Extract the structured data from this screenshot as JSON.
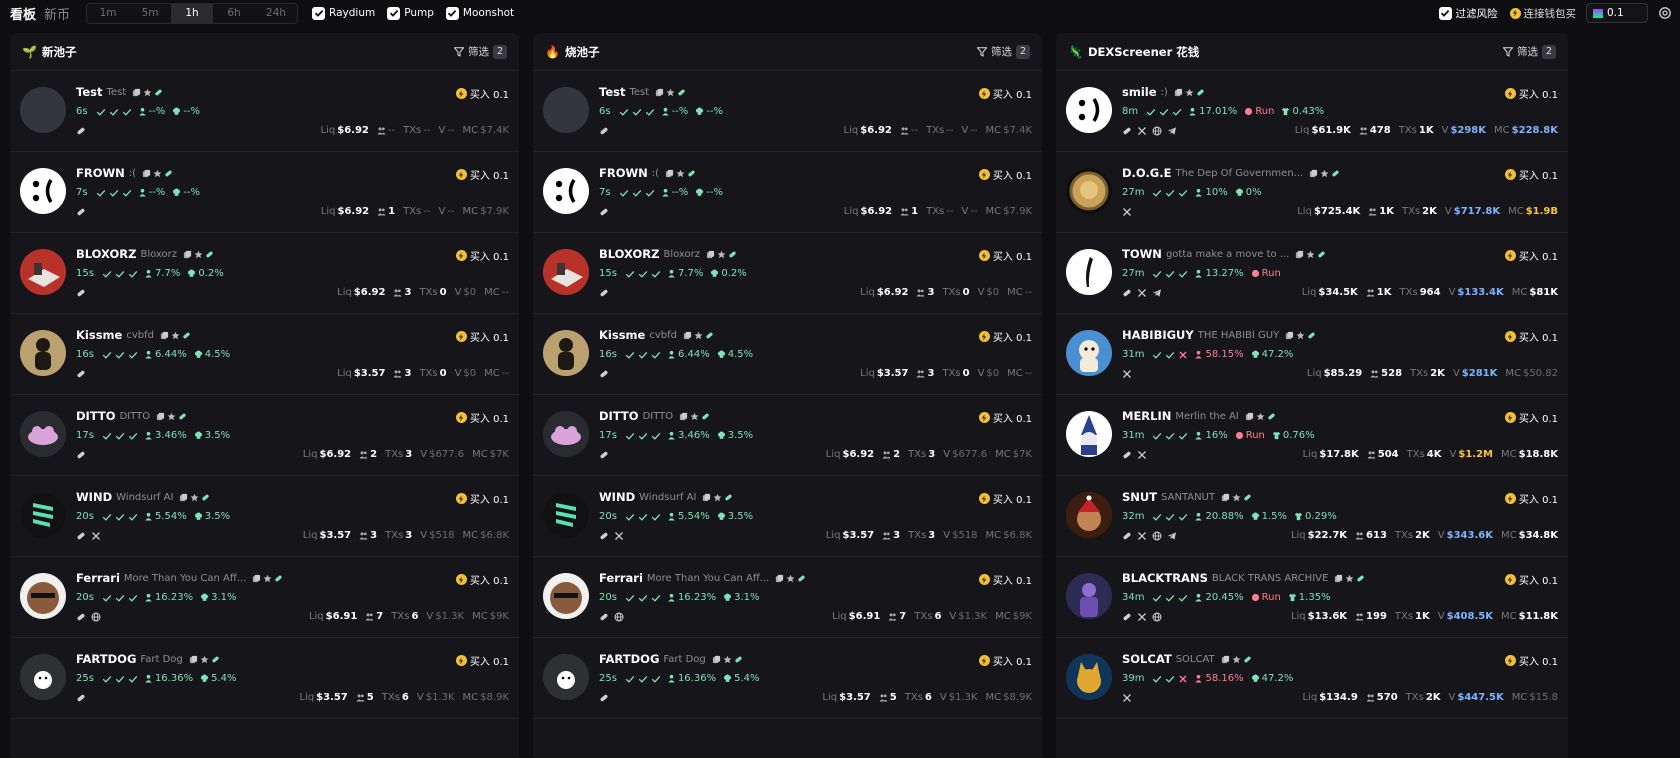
{
  "header": {
    "title": "看板",
    "subtitle": "新币",
    "timeframes": [
      "1m",
      "5m",
      "1h",
      "6h",
      "24h"
    ],
    "active_timeframe": "1h",
    "toggles": [
      "Raydium",
      "Pump",
      "Moonshot"
    ],
    "risk_filter": "过滤风险",
    "connect": "连接钱包买",
    "amount": "0.1"
  },
  "colors": {
    "accent_green": "#7fe3b3",
    "accent_red": "#ff7b8f",
    "accent_blue": "#7cb4ff",
    "accent_yellow": "#f5c542",
    "panel": "#16161a"
  },
  "metric_labels": {
    "liq": "Liq",
    "txs": "TXs",
    "vol": "V",
    "mc": "MC"
  },
  "buy_label": "买入 0.1",
  "filter_label": "筛选",
  "columns": [
    {
      "title": "新池子",
      "icon": "seedling-icon",
      "emoji": "🌱",
      "filter_count": "2",
      "rows": [
        {
          "name": "Test",
          "sub": "Test",
          "age": "6s",
          "c": [
            "g",
            "g",
            "g"
          ],
          "p1": "--%",
          "p2": "--%",
          "soc": [
            "pill"
          ],
          "liq": "$6.92",
          "holders": "--",
          "txs": "--",
          "v": "--",
          "mc": "$7.4K",
          "av": "blank"
        },
        {
          "name": "FROWN",
          "sub": ":(",
          "age": "7s",
          "c": [
            "g",
            "g",
            "g"
          ],
          "p1": "--%",
          "p2": "--%",
          "soc": [
            "pill"
          ],
          "liq": "$6.92",
          "holders": "1",
          "txs": "--",
          "v": "--",
          "mc": "$7.9K",
          "av": "frown"
        },
        {
          "name": "BLOXORZ",
          "sub": "Bloxorz",
          "age": "15s",
          "c": [
            "g",
            "g",
            "g"
          ],
          "p1": "7.7%",
          "p2": "0.2%",
          "soc": [
            "pill"
          ],
          "liq": "$6.92",
          "holders": "3",
          "txs": "0",
          "v": "$0",
          "mc": "--",
          "av": "blox"
        },
        {
          "name": "Kissme",
          "sub": "cvbfd",
          "age": "16s",
          "c": [
            "g",
            "g",
            "g"
          ],
          "p1": "6.44%",
          "p2": "4.5%",
          "soc": [
            "pill"
          ],
          "liq": "$3.57",
          "holders": "3",
          "txs": "0",
          "v": "$0",
          "mc": "--",
          "av": "kiss"
        },
        {
          "name": "DITTO",
          "sub": "DITTO",
          "age": "17s",
          "c": [
            "g",
            "g",
            "g"
          ],
          "p1": "3.46%",
          "p2": "3.5%",
          "soc": [
            "pill"
          ],
          "liq": "$6.92",
          "holders": "2",
          "txs": "3",
          "v": "$677.6",
          "mc": "$7K",
          "av": "ditto"
        },
        {
          "name": "WIND",
          "sub": "Windsurf AI",
          "age": "20s",
          "c": [
            "g",
            "g",
            "g"
          ],
          "p1": "5.54%",
          "p2": "3.5%",
          "soc": [
            "pill",
            "x"
          ],
          "liq": "$3.57",
          "holders": "3",
          "txs": "3",
          "v": "$518",
          "mc": "$6.8K",
          "av": "wind"
        },
        {
          "name": "Ferrari",
          "sub": "More Than You Can Aff...",
          "age": "20s",
          "c": [
            "g",
            "g",
            "g"
          ],
          "p1": "16.23%",
          "p2": "3.1%",
          "soc": [
            "pill",
            "web"
          ],
          "liq": "$6.91",
          "holders": "7",
          "txs": "6",
          "v": "$1.3K",
          "mc": "$9K",
          "av": "ferrari"
        },
        {
          "name": "FARTDOG",
          "sub": "Fart Dog",
          "age": "25s",
          "c": [
            "g",
            "g",
            "g"
          ],
          "p1": "16.36%",
          "p2": "5.4%",
          "soc": [
            "pill"
          ],
          "liq": "$3.57",
          "holders": "5",
          "txs": "6",
          "v": "$1.3K",
          "mc": "$8.9K",
          "av": "fart"
        }
      ]
    },
    {
      "title": "烧池子",
      "icon": "fire-icon",
      "emoji": "🔥",
      "filter_count": "2",
      "rows": [
        {
          "name": "Test",
          "sub": "Test",
          "age": "6s",
          "c": [
            "g",
            "g",
            "g"
          ],
          "p1": "--%",
          "p2": "--%",
          "soc": [
            "pill"
          ],
          "liq": "$6.92",
          "holders": "--",
          "txs": "--",
          "v": "--",
          "mc": "$7.4K",
          "av": "blank"
        },
        {
          "name": "FROWN",
          "sub": ":(",
          "age": "7s",
          "c": [
            "g",
            "g",
            "g"
          ],
          "p1": "--%",
          "p2": "--%",
          "soc": [
            "pill"
          ],
          "liq": "$6.92",
          "holders": "1",
          "txs": "--",
          "v": "--",
          "mc": "$7.9K",
          "av": "frown"
        },
        {
          "name": "BLOXORZ",
          "sub": "Bloxorz",
          "age": "15s",
          "c": [
            "g",
            "g",
            "g"
          ],
          "p1": "7.7%",
          "p2": "0.2%",
          "soc": [
            "pill"
          ],
          "liq": "$6.92",
          "holders": "3",
          "txs": "0",
          "v": "$0",
          "mc": "--",
          "av": "blox"
        },
        {
          "name": "Kissme",
          "sub": "cvbfd",
          "age": "16s",
          "c": [
            "g",
            "g",
            "g"
          ],
          "p1": "6.44%",
          "p2": "4.5%",
          "soc": [
            "pill"
          ],
          "liq": "$3.57",
          "holders": "3",
          "txs": "0",
          "v": "$0",
          "mc": "--",
          "av": "kiss"
        },
        {
          "name": "DITTO",
          "sub": "DITTO",
          "age": "17s",
          "c": [
            "g",
            "g",
            "g"
          ],
          "p1": "3.46%",
          "p2": "3.5%",
          "soc": [
            "pill"
          ],
          "liq": "$6.92",
          "holders": "2",
          "txs": "3",
          "v": "$677.6",
          "mc": "$7K",
          "av": "ditto"
        },
        {
          "name": "WIND",
          "sub": "Windsurf AI",
          "age": "20s",
          "c": [
            "g",
            "g",
            "g"
          ],
          "p1": "5.54%",
          "p2": "3.5%",
          "soc": [
            "pill",
            "x"
          ],
          "liq": "$3.57",
          "holders": "3",
          "txs": "3",
          "v": "$518",
          "mc": "$6.8K",
          "av": "wind"
        },
        {
          "name": "Ferrari",
          "sub": "More Than You Can Aff...",
          "age": "20s",
          "c": [
            "g",
            "g",
            "g"
          ],
          "p1": "16.23%",
          "p2": "3.1%",
          "soc": [
            "pill",
            "web"
          ],
          "liq": "$6.91",
          "holders": "7",
          "txs": "6",
          "v": "$1.3K",
          "mc": "$9K",
          "av": "ferrari"
        },
        {
          "name": "FARTDOG",
          "sub": "Fart Dog",
          "age": "25s",
          "c": [
            "g",
            "g",
            "g"
          ],
          "p1": "16.36%",
          "p2": "5.4%",
          "soc": [
            "pill"
          ],
          "liq": "$3.57",
          "holders": "5",
          "txs": "6",
          "v": "$1.3K",
          "mc": "$8.9K",
          "av": "fart"
        }
      ]
    },
    {
      "title": "DEXScreener 花钱",
      "icon": "dexscreener-icon",
      "emoji": "🦎",
      "filter_count": "2",
      "rows": [
        {
          "name": "smile",
          "sub": ":)",
          "age": "8m",
          "c": [
            "g",
            "g",
            "g"
          ],
          "p1": "17.01%",
          "p2": "Run",
          "p3": "0.43%",
          "soc": [
            "pill",
            "x",
            "web",
            "tg"
          ],
          "liq": "$61.9K",
          "holders": "478",
          "txs": "1K",
          "v": "$298K",
          "mc": "$228.8K",
          "vc": "blue",
          "mcc": "blue",
          "av": "smile"
        },
        {
          "name": "D.O.G.E",
          "sub": "The Dep Of Governmen...",
          "age": "27m",
          "c": [
            "g",
            "g",
            "g"
          ],
          "p1": "10%",
          "p2": "0%",
          "soc": [
            "x"
          ],
          "liq": "$725.4K",
          "holders": "1K",
          "txs": "2K",
          "v": "$717.8K",
          "mc": "$1.9B",
          "vc": "blue",
          "mcc": "yellow",
          "av": "doge"
        },
        {
          "name": "TOWN",
          "sub": "gotta make a move to ...",
          "age": "27m",
          "c": [
            "g",
            "g",
            "g"
          ],
          "p1": "13.27%",
          "p2": "Run",
          "soc": [
            "pill",
            "x",
            "tg"
          ],
          "liq": "$34.5K",
          "holders": "1K",
          "txs": "964",
          "v": "$133.4K",
          "mc": "$81K",
          "vc": "blue",
          "mcc": "white",
          "av": "town"
        },
        {
          "name": "HABIBIGUY",
          "sub": "THE HABIBI GUY",
          "age": "31m",
          "c": [
            "g",
            "g",
            "r"
          ],
          "p1": "58.15%",
          "p2": "47.2%",
          "p1c": "red",
          "soc": [
            "x"
          ],
          "liq": "$85.29",
          "holders": "528",
          "txs": "2K",
          "v": "$281K",
          "mc": "$50.82",
          "vc": "blue",
          "mcc": "dim",
          "av": "habibi"
        },
        {
          "name": "MERLIN",
          "sub": "Merlin the AI",
          "age": "31m",
          "c": [
            "g",
            "g",
            "g"
          ],
          "p1": "16%",
          "p2": "Run",
          "p3": "0.76%",
          "soc": [
            "pill",
            "x"
          ],
          "liq": "$17.8K",
          "holders": "504",
          "txs": "4K",
          "v": "$1.2M",
          "mc": "$18.8K",
          "vc": "yellow",
          "mcc": "white",
          "av": "merlin"
        },
        {
          "name": "SNUT",
          "sub": "SANTANUT",
          "age": "32m",
          "c": [
            "g",
            "g",
            "g"
          ],
          "p1": "20.88%",
          "p2": "1.5%",
          "p3": "0.29%",
          "soc": [
            "pill",
            "x",
            "web",
            "tg"
          ],
          "liq": "$22.7K",
          "holders": "613",
          "txs": "2K",
          "v": "$343.6K",
          "mc": "$34.8K",
          "vc": "blue",
          "mcc": "white",
          "av": "snut"
        },
        {
          "name": "BLACKTRANS",
          "sub": "BLACK TRANS ARCHIVE",
          "age": "34m",
          "c": [
            "g",
            "g",
            "g"
          ],
          "p1": "20.45%",
          "p2": "Run",
          "p3": "1.35%",
          "soc": [
            "pill",
            "x",
            "web"
          ],
          "liq": "$13.6K",
          "holders": "199",
          "txs": "1K",
          "v": "$408.5K",
          "mc": "$11.8K",
          "vc": "blue",
          "mcc": "white",
          "av": "black"
        },
        {
          "name": "SOLCAT",
          "sub": "SOLCAT",
          "age": "39m",
          "c": [
            "g",
            "g",
            "r"
          ],
          "p1": "58.16%",
          "p2": "47.2%",
          "p1c": "red",
          "soc": [
            "x"
          ],
          "liq": "$134.9",
          "holders": "570",
          "txs": "2K",
          "v": "$447.5K",
          "mc": "$15.8",
          "vc": "blue",
          "mcc": "dim",
          "av": "solcat"
        }
      ]
    }
  ]
}
